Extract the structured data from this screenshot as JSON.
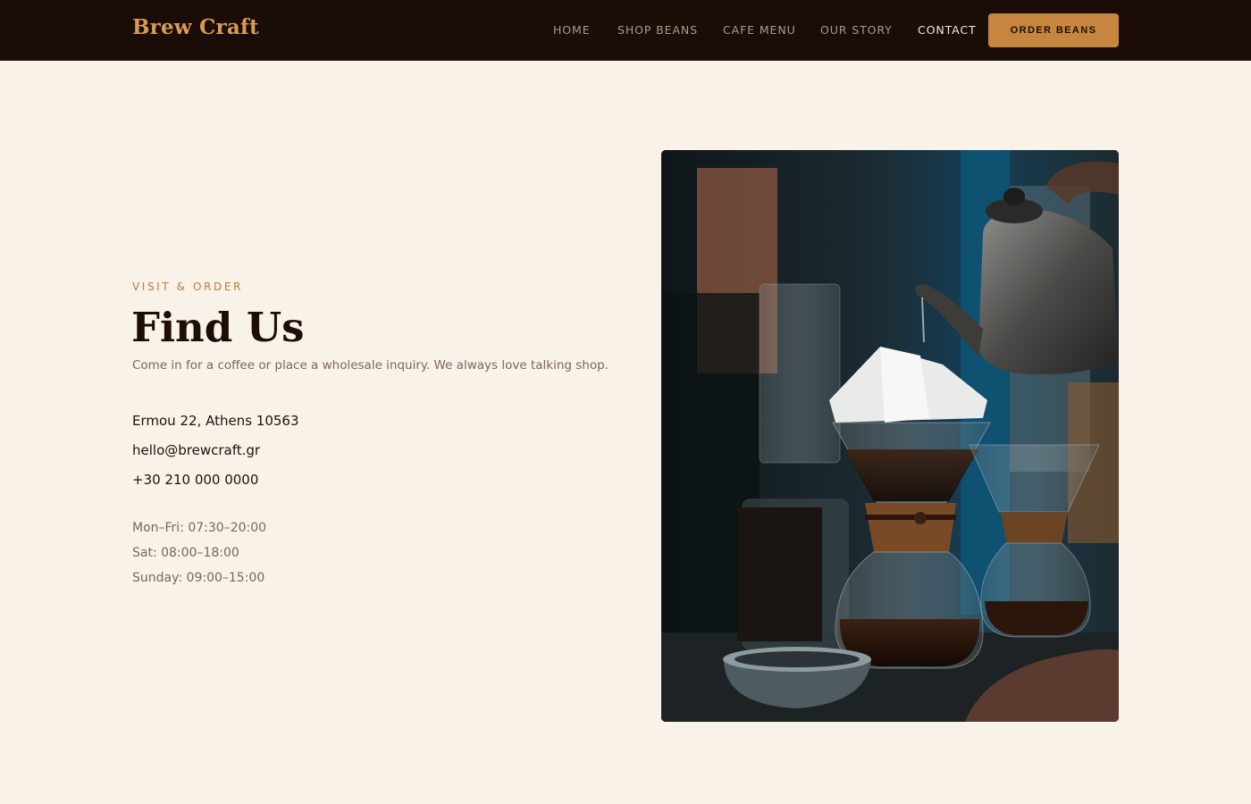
{
  "header": {
    "brand": "Brew Craft",
    "nav": [
      "HOME",
      "SHOP BEANS",
      "CAFE MENU",
      "OUR STORY",
      "CONTACT"
    ],
    "active": "CONTACT",
    "cta_label": "ORDER BEANS"
  },
  "main": {
    "eyebrow": "VISIT & ORDER",
    "title": "Find Us",
    "subtitle": "Come in for a coffee or place a wholesale inquiry. We always love talking shop.",
    "address": "Ermou 22, Athens 10563",
    "email": "hello@brewcraft.gr",
    "phone": "+30 210 000 0000",
    "hours": [
      "Mon–Fri: 07:30–20:00",
      "Sat: 08:00–18:00",
      "Sunday: 09:00–15:00"
    ]
  },
  "colors": {
    "nav_bg": "#1a0d07",
    "brand": "#d89b56",
    "accent": "#c78640",
    "page_bg": "#f9f2e9",
    "heading": "#1c0d06",
    "muted": "#7b6758"
  },
  "images": {
    "hero_photo": "pour-over-coffee-kettle-photo"
  }
}
